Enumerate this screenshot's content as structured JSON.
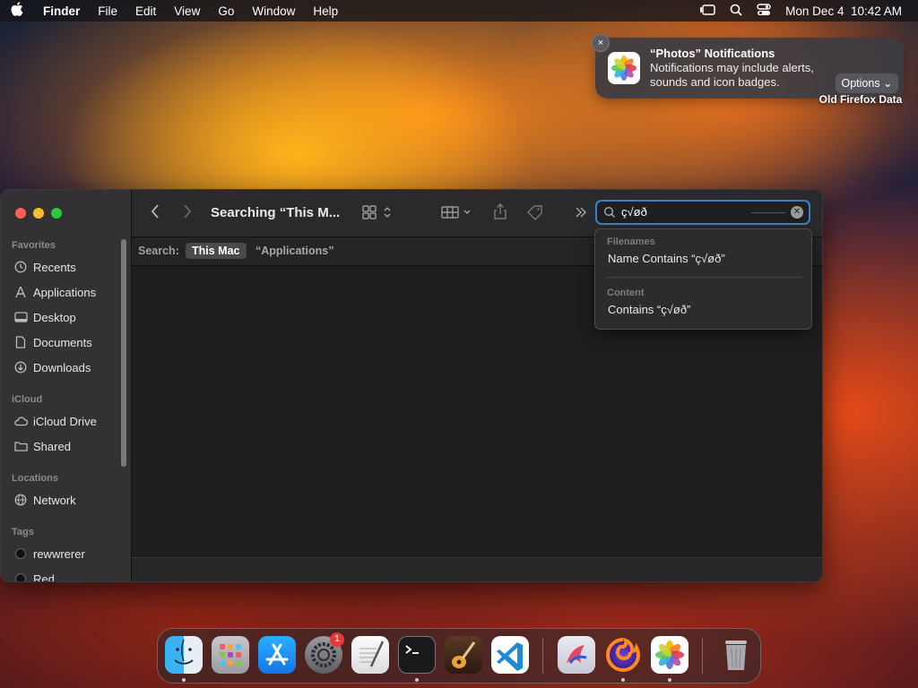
{
  "menubar": {
    "app": "Finder",
    "items": [
      "File",
      "Edit",
      "View",
      "Go",
      "Window",
      "Help"
    ],
    "datetime": "Mon Dec 4  10:42 AM"
  },
  "desktop": {
    "label": "Old Firefox Data"
  },
  "notification": {
    "title": "“Photos” Notifications",
    "body": "Notifications may include alerts, sounds and icon badges.",
    "options": "Options ⌄",
    "close": "×"
  },
  "finder": {
    "title": "Searching “This M...",
    "search_value": "ç√øð",
    "scope_label": "Search:",
    "scope_this_mac": "This Mac",
    "scope_apps": "“Applications”",
    "sidebar": {
      "favorites_label": "Favorites",
      "favorites": [
        "Recents",
        "Applications",
        "Desktop",
        "Documents",
        "Downloads"
      ],
      "icloud_label": "iCloud",
      "icloud": [
        "iCloud Drive",
        "Shared"
      ],
      "locations_label": "Locations",
      "locations": [
        "Network"
      ],
      "tags_label": "Tags",
      "tags": [
        "rewwrerer",
        "Red"
      ]
    },
    "dropdown": {
      "filenames_label": "Filenames",
      "name_contains": "Name Contains “ç√øð”",
      "content_label": "Content",
      "contains": "Contains “ç√øð”"
    }
  },
  "dock": {
    "settings_badge": "1"
  },
  "colors": {
    "accent": "#3b82c4",
    "close_red": "#ff5f57",
    "minimize_yellow": "#febc2e",
    "zoom_green": "#28c840"
  }
}
